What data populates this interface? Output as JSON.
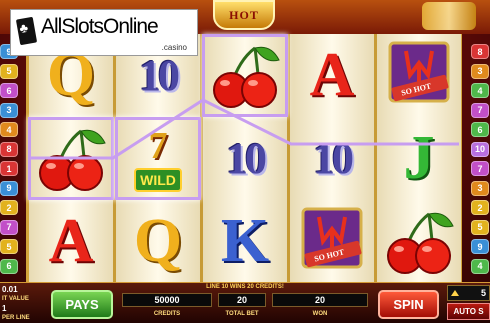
{
  "logo": {
    "main": "AllSlotsOnline",
    "sub": ".casino"
  },
  "game": {
    "title": "HOT"
  },
  "paylines": {
    "left": [
      {
        "n": "9",
        "color": "#3a8fd6"
      },
      {
        "n": "5",
        "color": "#e2b21e"
      },
      {
        "n": "6",
        "color": "#c24fc8"
      },
      {
        "n": "3",
        "color": "#3a8fd6"
      },
      {
        "n": "4",
        "color": "#e08a1d"
      },
      {
        "n": "8",
        "color": "#d93535"
      },
      {
        "n": "1",
        "color": "#d93535"
      },
      {
        "n": "9",
        "color": "#3a8fd6"
      },
      {
        "n": "2",
        "color": "#e2b21e"
      },
      {
        "n": "7",
        "color": "#c24fc8"
      },
      {
        "n": "5",
        "color": "#e2b21e"
      },
      {
        "n": "6",
        "color": "#4fb84b"
      }
    ],
    "right": [
      {
        "n": "8",
        "color": "#d93535"
      },
      {
        "n": "3",
        "color": "#e08a1d"
      },
      {
        "n": "4",
        "color": "#4fb84b"
      },
      {
        "n": "7",
        "color": "#c24fc8"
      },
      {
        "n": "6",
        "color": "#4fb84b"
      },
      {
        "n": "10",
        "color": "#b86fe0"
      },
      {
        "n": "7",
        "color": "#c24fc8"
      },
      {
        "n": "3",
        "color": "#e08a1d"
      },
      {
        "n": "2",
        "color": "#e2b21e"
      },
      {
        "n": "5",
        "color": "#e2b21e"
      },
      {
        "n": "9",
        "color": "#3a8fd6"
      },
      {
        "n": "4",
        "color": "#4fb84b"
      }
    ]
  },
  "reels": [
    [
      "Q",
      "cherries",
      "A"
    ],
    [
      "10",
      "wild",
      "Q"
    ],
    [
      "cherries",
      "10",
      "K"
    ],
    [
      "A",
      "10",
      "so-hot"
    ],
    [
      "so-hot",
      "J",
      "cherries"
    ]
  ],
  "symbols": {
    "wild_label": "WILD",
    "sohot_label": "SO HOT"
  },
  "win_message": "LINE 10 WINS 20 CREDITS!",
  "controls": {
    "coin_value": "0.01",
    "coin_value_label": "IT VALUE",
    "bet_per_line": "1",
    "bet_per_line_label": "PER LINE",
    "pays_label": "PAYS",
    "credits": "50000",
    "credits_label": "CREDITS",
    "total_bet": "20",
    "total_bet_label": "TOTAL BET",
    "won": "20",
    "won_label": "WON",
    "spin_label": "SPIN",
    "autospin_count": "5",
    "autospin_label": "AUTO S"
  },
  "colors": {
    "payline_highlight": "#c79df0",
    "frame_gold": "#d4a53c"
  }
}
